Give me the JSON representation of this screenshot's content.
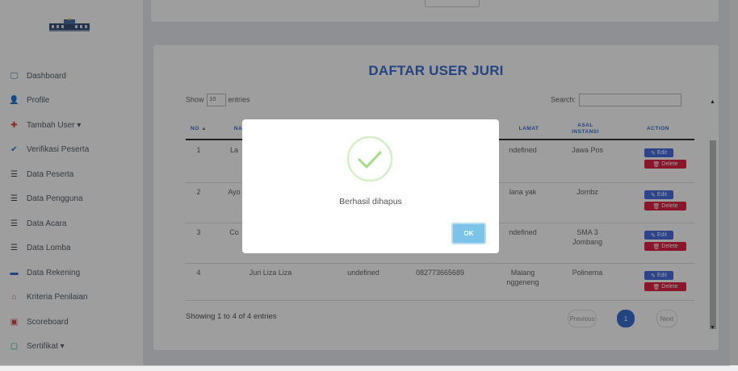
{
  "sidebar": {
    "items": [
      {
        "label": "Dashboard",
        "icon": "monitor-icon",
        "color": "#3a6fd0"
      },
      {
        "label": "Profile",
        "icon": "user-icon",
        "color": "#e2a020"
      },
      {
        "label": "Tambah User ▾",
        "icon": "plus-icon",
        "color": "#e04040"
      },
      {
        "label": "Verifikasi Peserta",
        "icon": "check-icon",
        "color": "#3a6fd0"
      },
      {
        "label": "Data Peserta",
        "icon": "list-icon",
        "color": "#444"
      },
      {
        "label": "Data Pengguna",
        "icon": "list-icon",
        "color": "#444"
      },
      {
        "label": "Data Acara",
        "icon": "list-icon",
        "color": "#444"
      },
      {
        "label": "Data Lomba",
        "icon": "list-icon",
        "color": "#444"
      },
      {
        "label": "Data Rekening",
        "icon": "credit-card-icon",
        "color": "#3a6fd0"
      },
      {
        "label": "Kriteria Penilaian",
        "icon": "bank-icon",
        "color": "#e06080"
      },
      {
        "label": "Scoreboard",
        "icon": "scoreboard-icon",
        "color": "#e04040"
      },
      {
        "label": "Sertifikat ▾",
        "icon": "certificate-icon",
        "color": "#30a090"
      }
    ]
  },
  "table": {
    "title": "DAFTAR USER JURI",
    "show_label": "Show",
    "show_value": "10",
    "entries_label": "entries",
    "search_label": "Search:",
    "headers": [
      "NO",
      "NA",
      "LAMAT",
      "ASAL INSTANSI",
      "ACTION"
    ],
    "rows": [
      {
        "no": "1",
        "nama": "La",
        "alamat": "ndefined",
        "instansi": "Jawa Pos"
      },
      {
        "no": "2",
        "nama": "Ayo",
        "alamat": "lana yak",
        "instansi": "Jombz"
      },
      {
        "no": "3",
        "nama": "Co",
        "alamat": "ndefined",
        "instansi": "SMA 3 Jombang"
      },
      {
        "no": "4",
        "nama": "Juri Liza Liza",
        "jk": "undefined",
        "telp": "082773665689",
        "alamat": "Malang nggeneng",
        "instansi": "Polinema"
      }
    ],
    "edit_label": "Edit",
    "delete_label": "Delete",
    "showing_text": "Showing 1 to 4 of 4 entries",
    "previous_label": "Previous",
    "page": "1",
    "next_label": "Next"
  },
  "modal": {
    "message": "Berhasil dihapus",
    "ok_label": "OK",
    "check_color": "#a5dc86"
  },
  "colors": {
    "accent": "#3a6fd0",
    "danger": "#e02546",
    "edit": "#4a6fe0"
  }
}
